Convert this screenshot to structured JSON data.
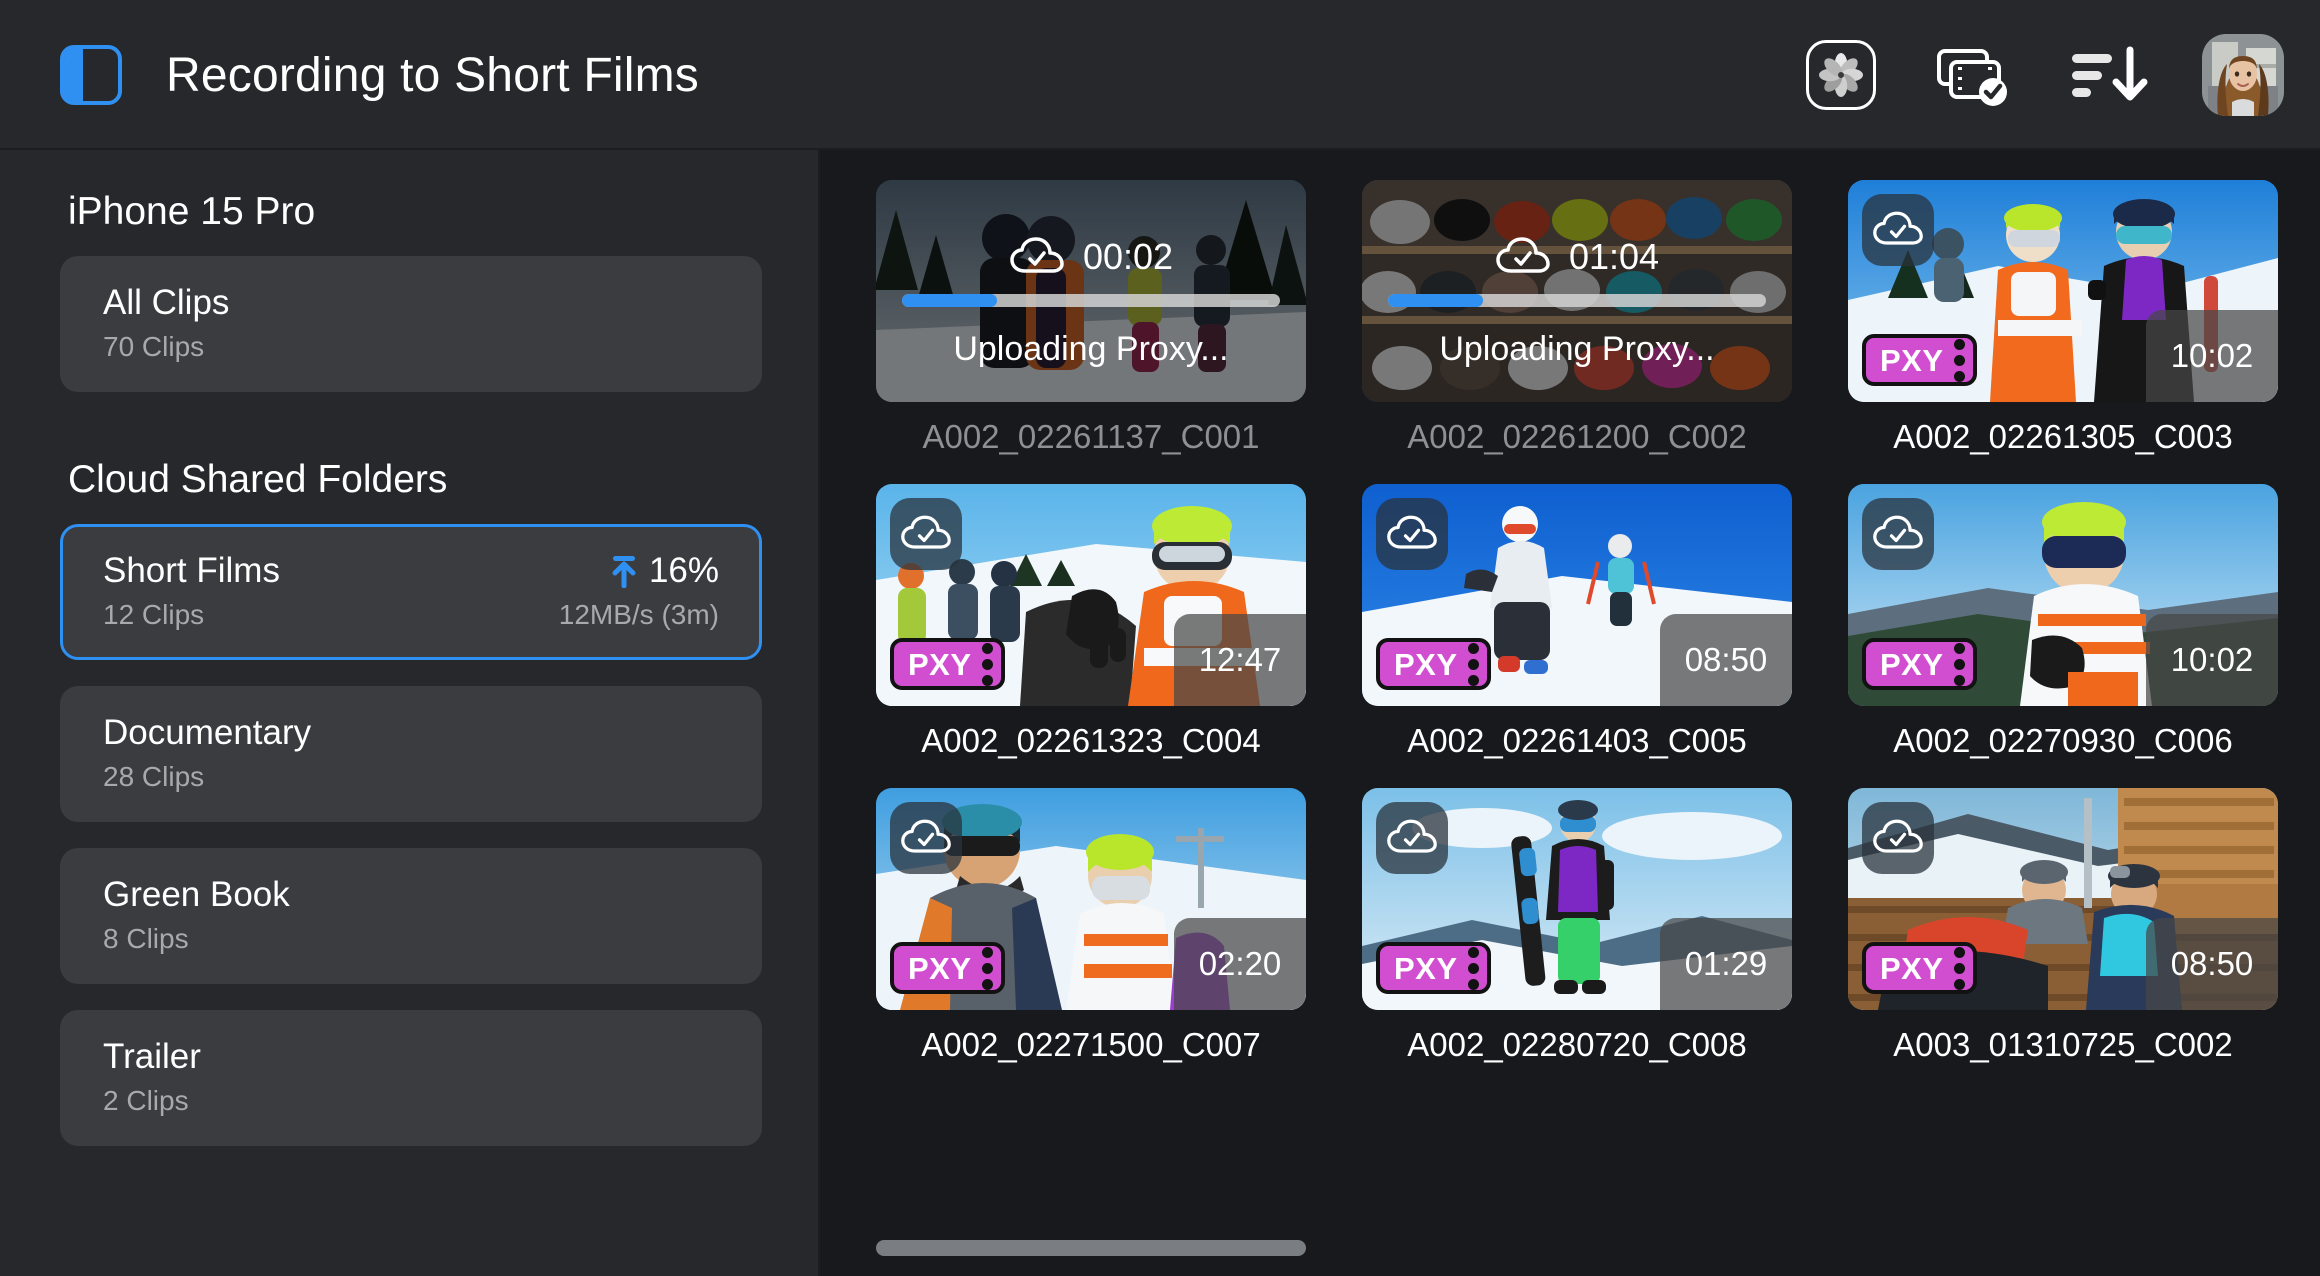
{
  "header": {
    "title": "Recording to Short Films",
    "sidebar_toggle_icon": "sidebar-toggle-icon",
    "actions": [
      {
        "icon": "aperture-flower-icon",
        "label": ""
      },
      {
        "icon": "clips-check-icon",
        "label": ""
      },
      {
        "icon": "sort-descending-icon",
        "label": ""
      }
    ],
    "avatar_icon": "user-avatar"
  },
  "sidebar": {
    "device_title": "iPhone 15 Pro",
    "all_clips": {
      "name": "All Clips",
      "count": "70 Clips"
    },
    "cloud_section_title": "Cloud Shared Folders",
    "folders": [
      {
        "name": "Short Films",
        "count": "12 Clips",
        "progress": "16%",
        "speed": "12MB/s (3m)",
        "selected": true,
        "upload_icon": "upload-arrow-icon"
      },
      {
        "name": "Documentary",
        "count": "28 Clips",
        "progress": "",
        "speed": "",
        "selected": false
      },
      {
        "name": "Green Book",
        "count": "8 Clips",
        "progress": "",
        "speed": "",
        "selected": false
      },
      {
        "name": "Trailer",
        "count": "2 Clips",
        "progress": "",
        "speed": "",
        "selected": false
      }
    ]
  },
  "main": {
    "clips": [
      {
        "name": "A002_02261137_C001",
        "duration": "00:02",
        "status": "uploading",
        "status_label": "Uploading Proxy...",
        "progress_pct": 25,
        "cloud_icon": "cloud-check-icon",
        "proxy_badge": "",
        "scene": "skiers-forest"
      },
      {
        "name": "A002_02261200_C002",
        "duration": "01:04",
        "status": "uploading",
        "status_label": "Uploading Proxy...",
        "progress_pct": 25,
        "cloud_icon": "cloud-check-icon",
        "proxy_badge": "",
        "scene": "helmet-shelf"
      },
      {
        "name": "A002_02261305_C003",
        "duration": "10:02",
        "status": "done",
        "status_label": "",
        "progress_pct": 100,
        "cloud_icon": "cloud-check-icon",
        "proxy_badge": "PXY",
        "scene": "couple-snow"
      },
      {
        "name": "A002_02261323_C004",
        "duration": "12:47",
        "status": "done",
        "status_label": "",
        "progress_pct": 100,
        "cloud_icon": "cloud-check-icon",
        "proxy_badge": "PXY",
        "scene": "snowboarder-goggles"
      },
      {
        "name": "A002_02261403_C005",
        "duration": "08:50",
        "status": "done",
        "status_label": "",
        "progress_pct": 100,
        "cloud_icon": "cloud-check-icon",
        "proxy_badge": "PXY",
        "scene": "skier-slope-blue"
      },
      {
        "name": "A002_02270930_C006",
        "duration": "10:02",
        "status": "done",
        "status_label": "",
        "progress_pct": 100,
        "cloud_icon": "cloud-check-icon",
        "proxy_badge": "PXY",
        "scene": "woman-phone-snow"
      },
      {
        "name": "A002_02271500_C007",
        "duration": "02:20",
        "status": "done",
        "status_label": "",
        "progress_pct": 100,
        "cloud_icon": "cloud-check-icon",
        "proxy_badge": "PXY",
        "scene": "bearded-man-couple"
      },
      {
        "name": "A002_02280720_C008",
        "duration": "01:29",
        "status": "done",
        "status_label": "",
        "progress_pct": 100,
        "cloud_icon": "cloud-check-icon",
        "proxy_badge": "PXY",
        "scene": "snowboarder-standing"
      },
      {
        "name": "A003_01310725_C002",
        "duration": "08:50",
        "status": "done",
        "status_label": "",
        "progress_pct": 100,
        "cloud_icon": "cloud-check-icon",
        "proxy_badge": "PXY",
        "scene": "lodge-deck"
      }
    ],
    "scrollbar": {
      "thumb_left_pct": 0,
      "thumb_width_pct": 31
    }
  },
  "colors": {
    "accent_blue": "#2f90f2",
    "proxy_magenta": "#d14ed1",
    "sidebar_bg": "#26282b",
    "main_bg": "#17191c",
    "row_bg": "#3a3c40"
  }
}
